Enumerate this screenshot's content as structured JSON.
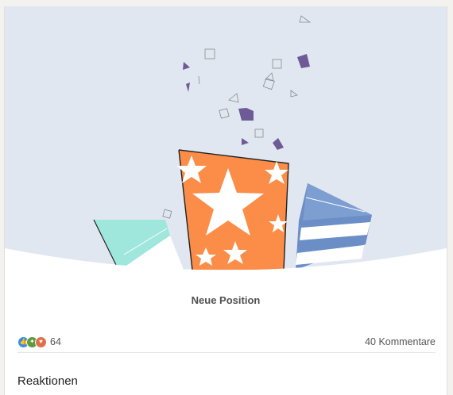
{
  "post": {
    "caption": "Neue Position"
  },
  "social": {
    "reaction_count": "64",
    "comments": "40 Kommentare",
    "reaction_types": [
      "like-icon",
      "celebrate-icon",
      "love-icon"
    ]
  },
  "reactions_section": {
    "title": "Reaktionen"
  },
  "colors": {
    "sky": "#e1e7f0",
    "orange": "#fb8d48",
    "mint": "#9fe6dc",
    "blue": "#6b8ec7",
    "confetti": "#6e5a96"
  }
}
